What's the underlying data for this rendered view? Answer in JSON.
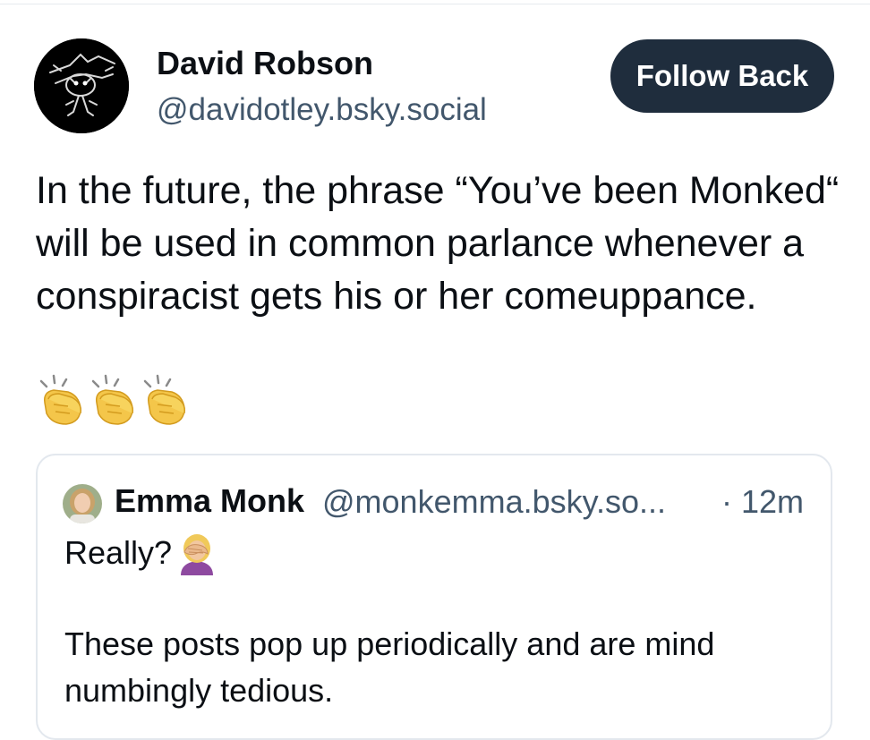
{
  "post": {
    "author_name": "David Robson",
    "author_handle": "@davidotley.bsky.social",
    "follow_button_label": "Follow Back",
    "text": "In the future, the phrase “You’ve been Monked“ will be used in common parlance whenever a conspiracist gets his or her comeuppance.",
    "emojis": [
      "clapping-hands-icon",
      "clapping-hands-icon",
      "clapping-hands-icon"
    ]
  },
  "quote": {
    "author_name": "Emma Monk",
    "author_handle": "@monkemma.bsky.so...",
    "timestamp": "· 12m",
    "line1": "Really?",
    "line1_emoji": "facepalm-icon",
    "body": "These posts pop up periodically and are mind numbingly tedious."
  },
  "colors": {
    "button_bg": "#1f2d3d",
    "handle": "#42576c",
    "text": "#0b0f14",
    "card_border": "#e3e8ee"
  }
}
